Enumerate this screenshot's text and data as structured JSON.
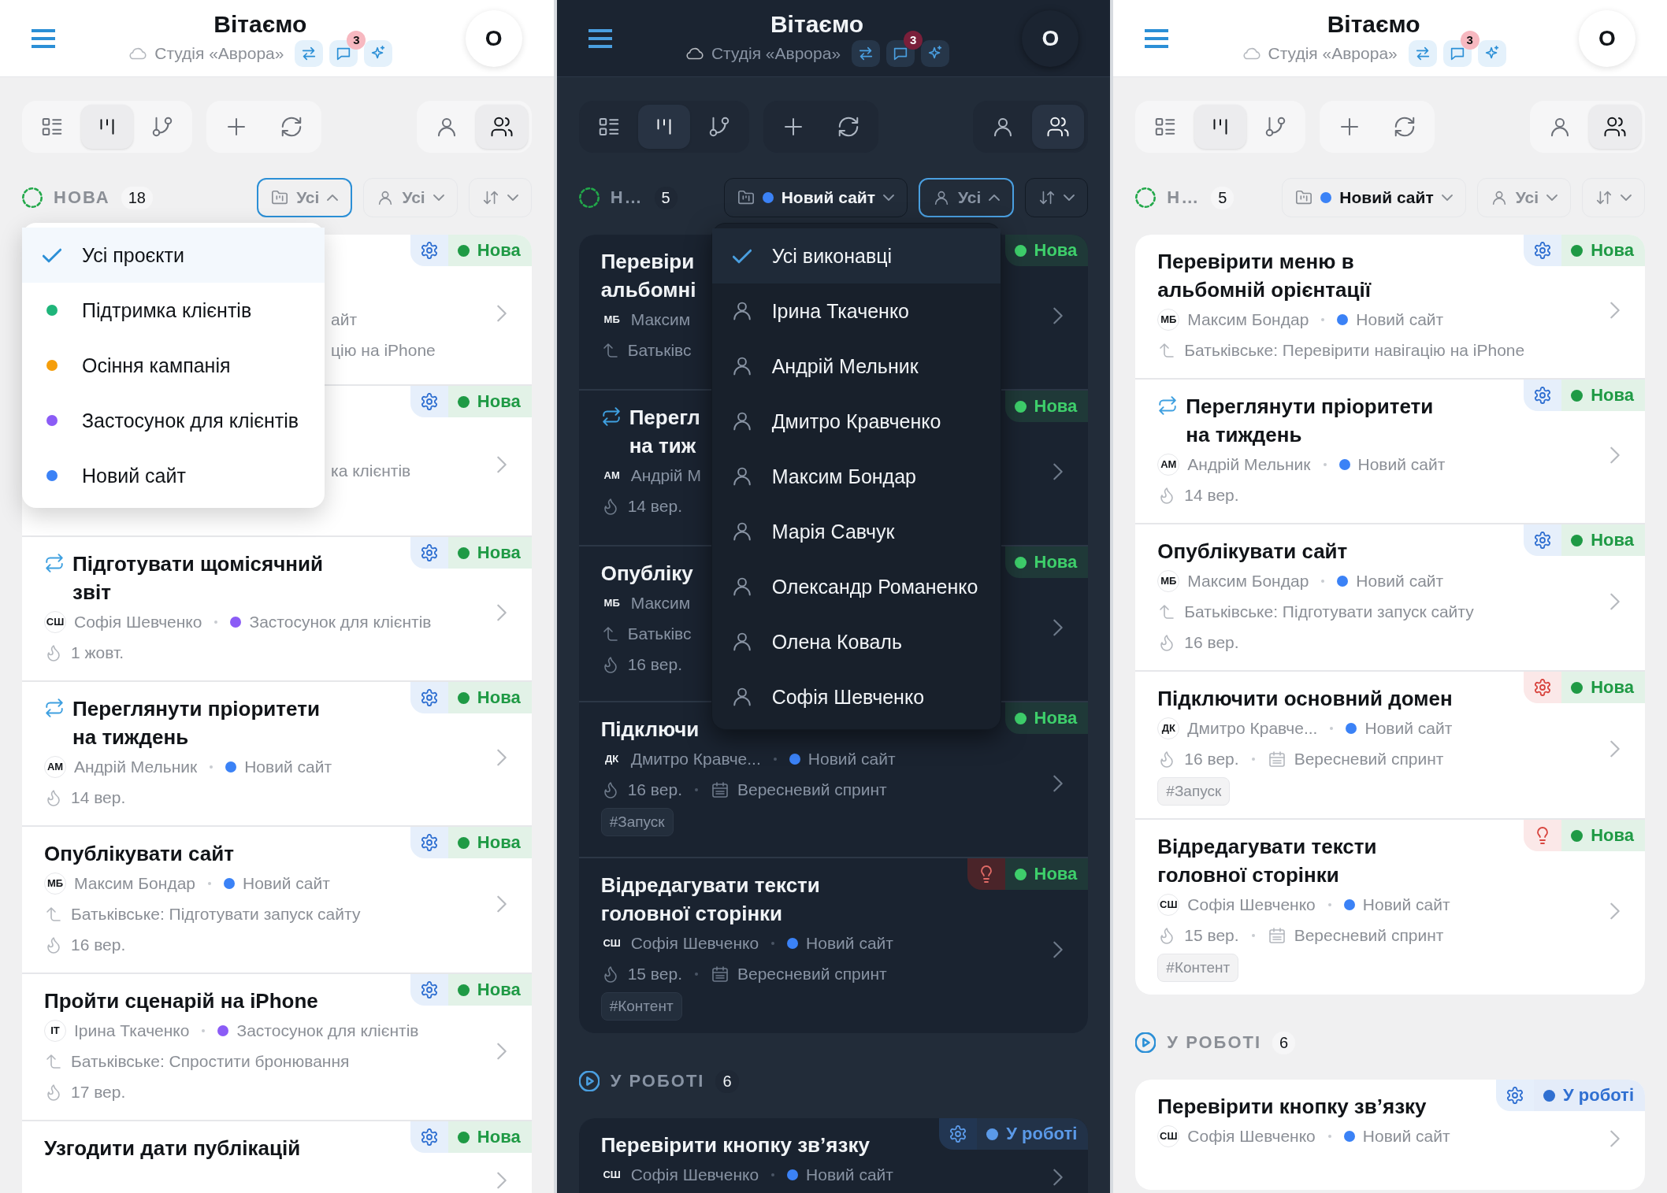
{
  "screens": [
    {
      "kind": "light",
      "header": {
        "title": "Вітаємо",
        "workspace": "Студія «Аврора»",
        "badge": "3",
        "avatar": "О"
      },
      "toolbar": {
        "views": [
          {
            "kind": "list",
            "selected": false
          },
          {
            "kind": "board",
            "selected": true
          },
          {
            "kind": "tree",
            "selected": false
          }
        ],
        "scopes": [
          {
            "kind": "me",
            "selected": false
          },
          {
            "kind": "team",
            "selected": true
          }
        ]
      },
      "column": {
        "label": "НОВА",
        "count": "18"
      },
      "filters": {
        "project": {
          "value": "Усі",
          "open": true
        },
        "assignee": {
          "value": "Усі",
          "open": false
        },
        "sort": {
          "open": false
        }
      },
      "dropdown": {
        "kind": "projects",
        "items": [
          {
            "label": "Усі проєкти",
            "selected": true
          },
          {
            "label": "Підтримка клієнтів",
            "selected": false,
            "color": "#1fb57a"
          },
          {
            "label": "Осіння кампанія",
            "selected": false,
            "color": "#f59e0b"
          },
          {
            "label": "Застосунок для клієнтів",
            "selected": false,
            "color": "#8b5cf6"
          },
          {
            "label": "Новий сайт",
            "selected": false,
            "color": "#3b82f6"
          }
        ]
      },
      "cards": [
        {
          "kind": "covered",
          "fragments": [
            "айт",
            "цію на iPhone"
          ],
          "priority": {
            "kind": "gear",
            "alert": false
          },
          "status": {
            "label": "Нова",
            "color": "#1f9a45"
          }
        },
        {
          "kind": "covered",
          "fragments": [
            "ка клієнтів"
          ],
          "priority": {
            "kind": "gear",
            "alert": false
          },
          "status": {
            "label": "Нова",
            "color": "#1f9a45"
          }
        },
        {
          "kind": "task",
          "title": "Підготувати щомісячний звіт",
          "recurring": true,
          "priority": {
            "kind": "gear",
            "alert": false
          },
          "status": {
            "label": "Нова",
            "color": "#1f9a45"
          },
          "assignee_initials": "СШ",
          "assignee": "Софія Шевченко",
          "project": {
            "name": "Застосунок для клієнтів",
            "color": "#8b5cf6"
          },
          "due": "1 жовт."
        },
        {
          "kind": "task",
          "title": "Переглянути пріоритети на тиждень",
          "recurring": true,
          "priority": {
            "kind": "gear",
            "alert": false
          },
          "status": {
            "label": "Нова",
            "color": "#1f9a45"
          },
          "assignee_initials": "АМ",
          "assignee": "Андрій Мельник",
          "project": {
            "name": "Новий сайт",
            "color": "#3b82f6"
          },
          "due": "14 вер."
        },
        {
          "kind": "task",
          "title": "Опублікувати сайт",
          "recurring": false,
          "priority": {
            "kind": "gear",
            "alert": false
          },
          "status": {
            "label": "Нова",
            "color": "#1f9a45"
          },
          "assignee_initials": "МБ",
          "assignee": "Максим Бондар",
          "project": {
            "name": "Новий сайт",
            "color": "#3b82f6"
          },
          "parent": "Батьківське: Підготувати запуск сайту",
          "due": "16 вер."
        },
        {
          "kind": "task",
          "title": "Пройти сценарій на iPhone",
          "recurring": false,
          "priority": {
            "kind": "gear",
            "alert": false
          },
          "status": {
            "label": "Нова",
            "color": "#1f9a45"
          },
          "assignee_initials": "ІТ",
          "assignee": "Ірина Ткаченко",
          "project": {
            "name": "Застосунок для клієнтів",
            "color": "#8b5cf6"
          },
          "parent": "Батьківське: Спростити бронювання",
          "due": "17 вер."
        },
        {
          "kind": "task",
          "title": "Узгодити дати публікацій",
          "recurring": false,
          "priority": {
            "kind": "gear",
            "alert": false
          },
          "status": {
            "label": "Нова",
            "color": "#1f9a45"
          }
        }
      ]
    },
    {
      "kind": "dark",
      "header": {
        "title": "Вітаємо",
        "workspace": "Студія «Аврора»",
        "badge": "3",
        "avatar": "О"
      },
      "toolbar": {
        "views": [
          {
            "kind": "list",
            "selected": false
          },
          {
            "kind": "board",
            "selected": true
          },
          {
            "kind": "tree",
            "selected": false
          }
        ],
        "scopes": [
          {
            "kind": "me",
            "selected": false
          },
          {
            "kind": "team",
            "selected": true
          }
        ]
      },
      "column": {
        "label": "Н…",
        "count": "5"
      },
      "filters": {
        "project": {
          "value": "Новий сайт",
          "color": "#3b82f6",
          "open": false
        },
        "assignee": {
          "value": "Усі",
          "open": true
        },
        "sort": {
          "open": false
        }
      },
      "dropdown": {
        "kind": "assignees",
        "items": [
          {
            "label": "Усі виконавці",
            "selected": true
          },
          {
            "label": "Ірина Ткаченко",
            "selected": false
          },
          {
            "label": "Андрій Мельник",
            "selected": false
          },
          {
            "label": "Дмитро Кравченко",
            "selected": false
          },
          {
            "label": "Максим Бондар",
            "selected": false
          },
          {
            "label": "Марія Савчук",
            "selected": false
          },
          {
            "label": "Олександр Романенко",
            "selected": false
          },
          {
            "label": "Олена Коваль",
            "selected": false
          },
          {
            "label": "Софія Шевченко",
            "selected": false
          }
        ]
      },
      "cards": [
        {
          "kind": "clipped",
          "title_lines": [
            "Перевіри",
            "альбомні"
          ],
          "recurring": false,
          "status": {
            "label": "Нова",
            "color": "#3ecf6b"
          },
          "assignee_initials": "МБ",
          "assignee": "Максим",
          "parent": "Батьківс"
        },
        {
          "kind": "clipped",
          "title_lines": [
            "Перегл",
            "на тиж"
          ],
          "recurring": true,
          "status": {
            "label": "Нова",
            "color": "#3ecf6b"
          },
          "assignee_initials": "АМ",
          "assignee": "Андрій М",
          "due": "14 вер."
        },
        {
          "kind": "clipped",
          "title_lines": [
            "Опубліку"
          ],
          "recurring": false,
          "status": {
            "label": "Нова",
            "color": "#3ecf6b"
          },
          "assignee_initials": "МБ",
          "assignee": "Максим",
          "parent": "Батьківс",
          "due": "16 вер."
        },
        {
          "kind": "clipped",
          "title_lines": [
            "Підключи"
          ],
          "recurring": false,
          "status": {
            "label": "Нова",
            "color": "#3ecf6b"
          },
          "assignee_initials": "ДК",
          "assignee": "Дмитро Кравче...",
          "project": {
            "name": "Новий сайт",
            "color": "#3b82f6"
          },
          "due": "16 вер.",
          "sprint": "Вересневий спринт",
          "tags": [
            "#Запуск"
          ]
        },
        {
          "kind": "task",
          "title": "Відредагувати тексти головної сторінки",
          "recurring": false,
          "priority": {
            "kind": "bulb",
            "alert": true
          },
          "status": {
            "label": "Нова",
            "color": "#3ecf6b"
          },
          "assignee_initials": "СШ",
          "assignee": "Софія Шевченко",
          "project": {
            "name": "Новий сайт",
            "color": "#3b82f6"
          },
          "due": "15 вер.",
          "sprint": "Вересневий спринт",
          "tags": [
            "#Контент"
          ]
        }
      ],
      "next_section": {
        "label": "У РОБОТІ",
        "count": "6",
        "cards": [
          {
            "kind": "task",
            "title": "Перевірити кнопку зв’язку",
            "recurring": false,
            "priority": {
              "kind": "gear",
              "alert": false
            },
            "status": {
              "label": "У роботі",
              "color": "#5b9ae8"
            },
            "assignee_initials": "СШ",
            "assignee": "Софія Шевченко",
            "project": {
              "name": "Новий сайт",
              "color": "#3b82f6"
            }
          }
        ]
      }
    },
    {
      "kind": "light",
      "header": {
        "title": "Вітаємо",
        "workspace": "Студія «Аврора»",
        "badge": "3",
        "avatar": "О"
      },
      "toolbar": {
        "views": [
          {
            "kind": "list",
            "selected": false
          },
          {
            "kind": "board",
            "selected": true
          },
          {
            "kind": "tree",
            "selected": false
          }
        ],
        "scopes": [
          {
            "kind": "me",
            "selected": false
          },
          {
            "kind": "team",
            "selected": true
          }
        ]
      },
      "column": {
        "label": "Н…",
        "count": "5"
      },
      "filters": {
        "project": {
          "value": "Новий сайт",
          "color": "#3b82f6",
          "open": false
        },
        "assignee": {
          "value": "Усі",
          "open": false
        },
        "sort": {
          "open": false
        }
      },
      "cards": [
        {
          "kind": "task",
          "title": "Перевірити меню в альбомній орієнтації",
          "recurring": false,
          "priority": {
            "kind": "gear",
            "alert": false
          },
          "status": {
            "label": "Нова",
            "color": "#1f9a45"
          },
          "assignee_initials": "МБ",
          "assignee": "Максим Бондар",
          "project": {
            "name": "Новий сайт",
            "color": "#3b82f6"
          },
          "parent": "Батьківське: Перевірити навігацію на iPhone"
        },
        {
          "kind": "task",
          "title": "Переглянути пріоритети на тиждень",
          "recurring": true,
          "priority": {
            "kind": "gear",
            "alert": false
          },
          "status": {
            "label": "Нова",
            "color": "#1f9a45"
          },
          "assignee_initials": "АМ",
          "assignee": "Андрій Мельник",
          "project": {
            "name": "Новий сайт",
            "color": "#3b82f6"
          },
          "due": "14 вер."
        },
        {
          "kind": "task",
          "title": "Опублікувати сайт",
          "recurring": false,
          "priority": {
            "kind": "gear",
            "alert": false
          },
          "status": {
            "label": "Нова",
            "color": "#1f9a45"
          },
          "assignee_initials": "МБ",
          "assignee": "Максим Бондар",
          "project": {
            "name": "Новий сайт",
            "color": "#3b82f6"
          },
          "parent": "Батьківське: Підготувати запуск сайту",
          "due": "16 вер."
        },
        {
          "kind": "task",
          "title": "Підключити основний домен",
          "recurring": false,
          "priority": {
            "kind": "gear",
            "alert": true
          },
          "status": {
            "label": "Нова",
            "color": "#1f9a45"
          },
          "assignee_initials": "ДК",
          "assignee": "Дмитро Кравче...",
          "project": {
            "name": "Новий сайт",
            "color": "#3b82f6"
          },
          "due": "16 вер.",
          "sprint": "Вересневий спринт",
          "tags": [
            "#Запуск"
          ]
        },
        {
          "kind": "task",
          "title": "Відредагувати тексти головної сторінки",
          "recurring": false,
          "priority": {
            "kind": "bulb",
            "alert": true
          },
          "status": {
            "label": "Нова",
            "color": "#1f9a45"
          },
          "assignee_initials": "СШ",
          "assignee": "Софія Шевченко",
          "project": {
            "name": "Новий сайт",
            "color": "#3b82f6"
          },
          "due": "15 вер.",
          "sprint": "Вересневий спринт",
          "tags": [
            "#Контент"
          ]
        }
      ],
      "next_section": {
        "label": "У РОБОТІ",
        "count": "6",
        "cards": [
          {
            "kind": "task",
            "title": "Перевірити кнопку зв’язку",
            "recurring": false,
            "priority": {
              "kind": "gear",
              "alert": false
            },
            "status": {
              "label": "У роботі",
              "color": "#2f6fd1"
            },
            "assignee_initials": "СШ",
            "assignee": "Софія Шевченко",
            "project": {
              "name": "Новий сайт",
              "color": "#3b82f6"
            }
          }
        ]
      }
    }
  ]
}
